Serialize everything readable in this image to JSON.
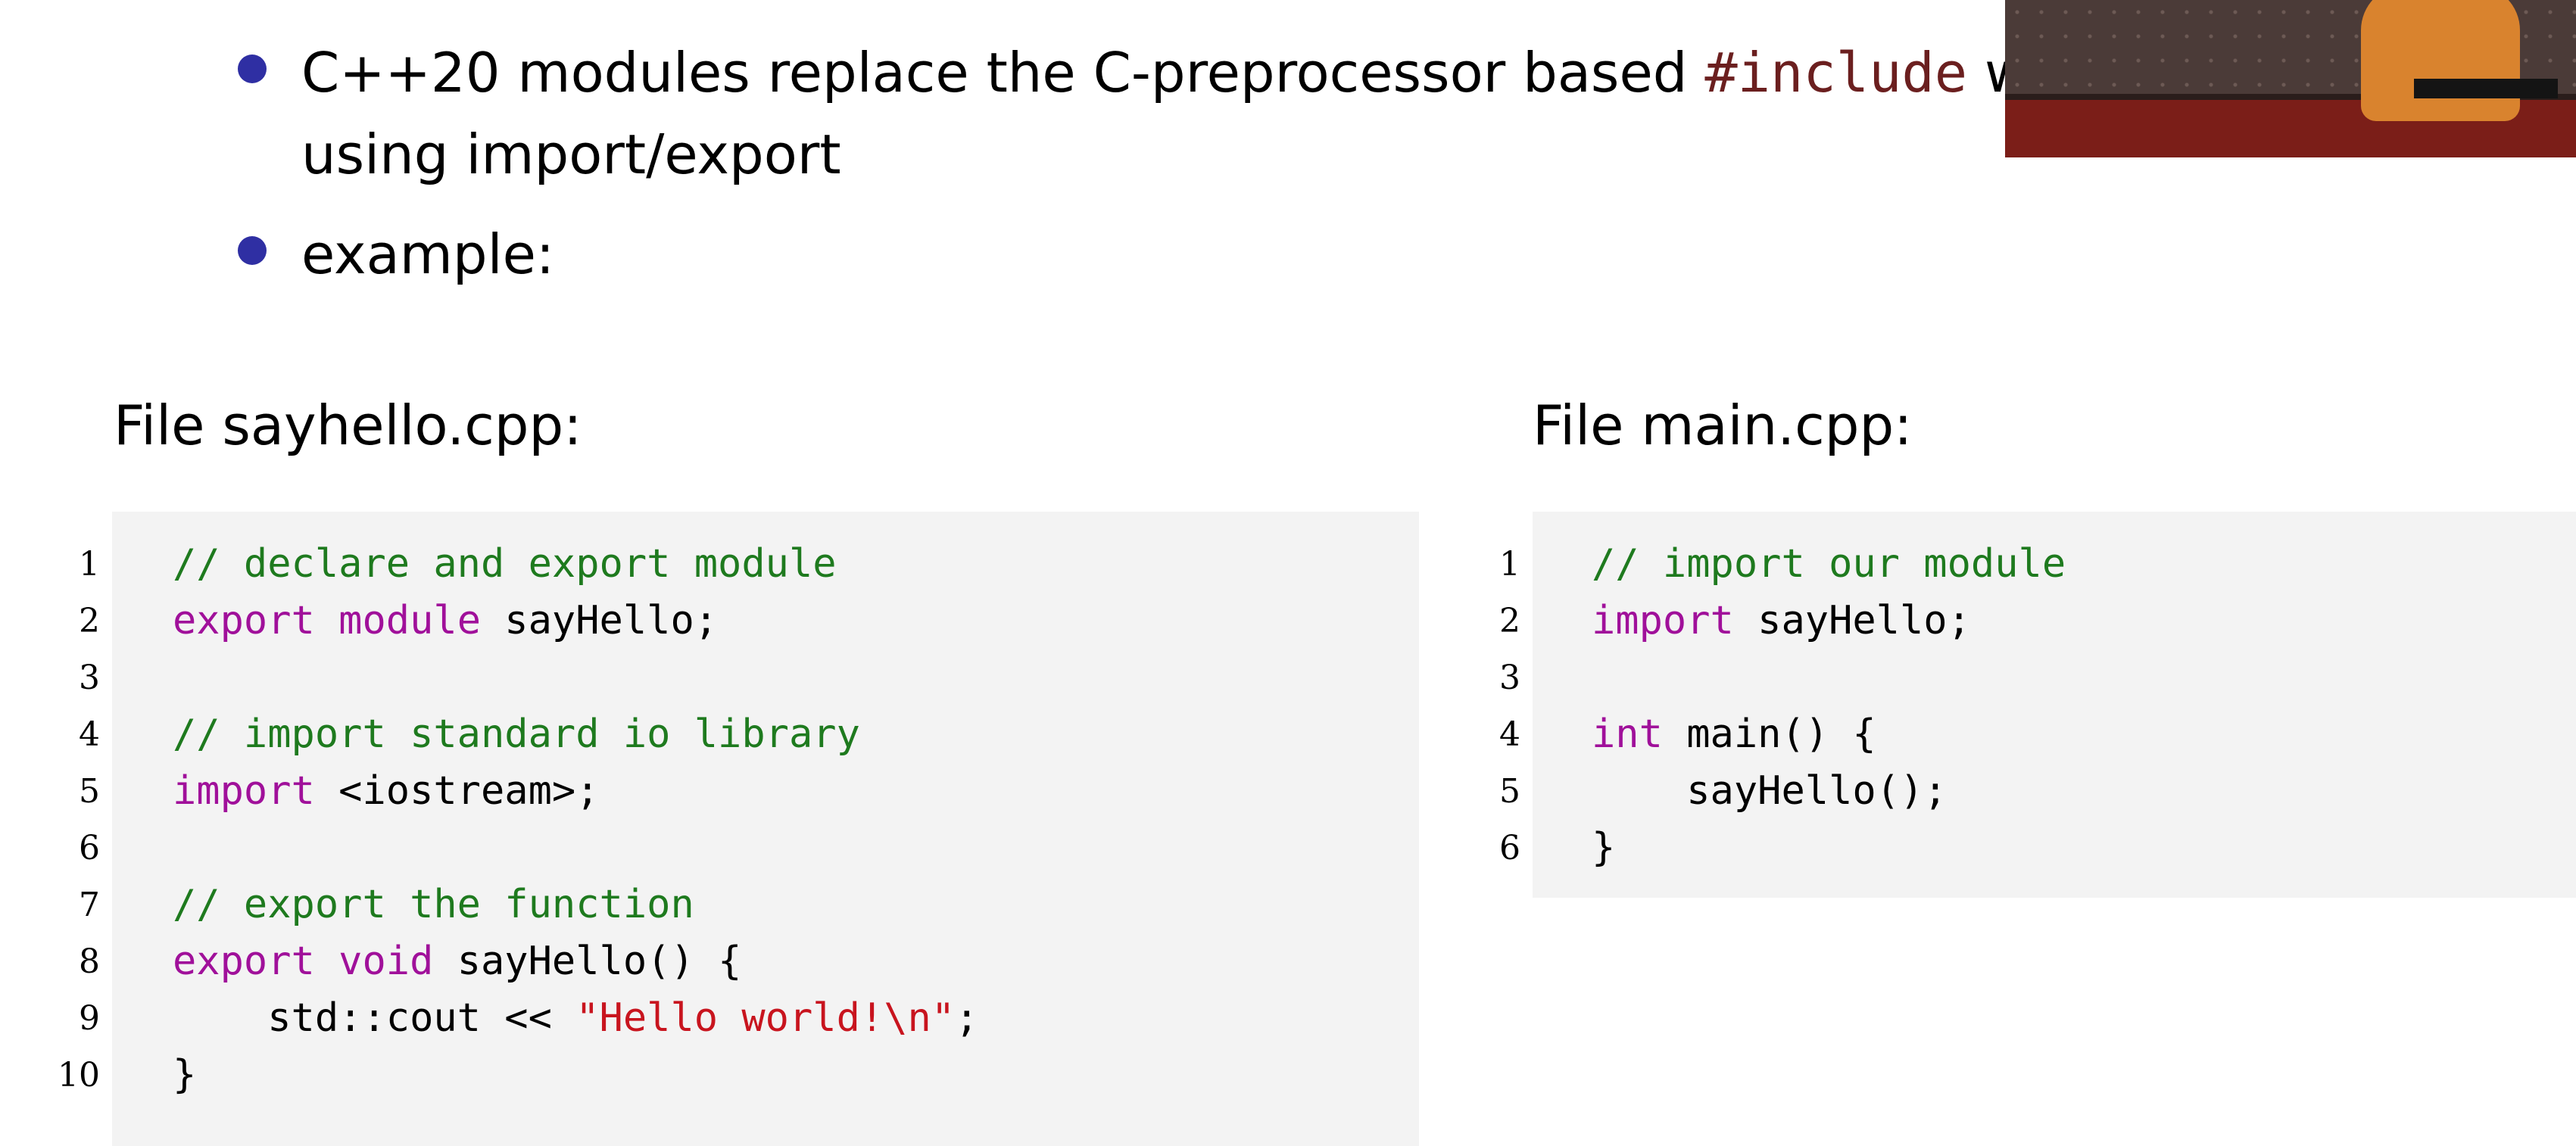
{
  "colors": {
    "bullet": "#2f2fa3",
    "comment": "#1e7a1e",
    "keyword": "#a0109a",
    "string": "#c8141e",
    "inline_code": "#6b1f1f",
    "code_background": "#f3f3f3"
  },
  "bullets": [
    {
      "line1_prefix": "C++20 modules replace the C-preprocessor based ",
      "line1_code": "#include",
      "line1_suffix": " w",
      "line2": "using import/export"
    },
    {
      "line1": "example:"
    }
  ],
  "left_file": {
    "title": "File sayhello.cpp:",
    "lines": [
      {
        "num": "1",
        "tokens": [
          {
            "type": "comment",
            "text": "// declare and export module"
          }
        ]
      },
      {
        "num": "2",
        "tokens": [
          {
            "type": "keyword",
            "text": "export"
          },
          {
            "type": "plain",
            "text": " "
          },
          {
            "type": "keyword",
            "text": "module"
          },
          {
            "type": "plain",
            "text": " sayHello;"
          }
        ]
      },
      {
        "num": "3",
        "tokens": []
      },
      {
        "num": "4",
        "tokens": [
          {
            "type": "comment",
            "text": "// import standard io library"
          }
        ]
      },
      {
        "num": "5",
        "tokens": [
          {
            "type": "keyword",
            "text": "import"
          },
          {
            "type": "plain",
            "text": " <iostream>;"
          }
        ]
      },
      {
        "num": "6",
        "tokens": []
      },
      {
        "num": "7",
        "tokens": [
          {
            "type": "comment",
            "text": "// export the function"
          }
        ]
      },
      {
        "num": "8",
        "tokens": [
          {
            "type": "keyword",
            "text": "export"
          },
          {
            "type": "plain",
            "text": " "
          },
          {
            "type": "keyword",
            "text": "void"
          },
          {
            "type": "plain",
            "text": " sayHello() {"
          }
        ]
      },
      {
        "num": "9",
        "tokens": [
          {
            "type": "plain",
            "text": "    std::cout << "
          },
          {
            "type": "string",
            "text": "\"Hello world!\\n\""
          },
          {
            "type": "plain",
            "text": ";"
          }
        ]
      },
      {
        "num": "10",
        "tokens": [
          {
            "type": "plain",
            "text": "}"
          }
        ]
      }
    ]
  },
  "right_file": {
    "title": "File main.cpp:",
    "lines": [
      {
        "num": "1",
        "tokens": [
          {
            "type": "comment",
            "text": "// import our module"
          }
        ]
      },
      {
        "num": "2",
        "tokens": [
          {
            "type": "keyword",
            "text": "import"
          },
          {
            "type": "plain",
            "text": " sayHello;"
          }
        ]
      },
      {
        "num": "3",
        "tokens": []
      },
      {
        "num": "4",
        "tokens": [
          {
            "type": "keyword",
            "text": "int"
          },
          {
            "type": "plain",
            "text": " main() {"
          }
        ]
      },
      {
        "num": "5",
        "tokens": [
          {
            "type": "plain",
            "text": "    sayHello();"
          }
        ]
      },
      {
        "num": "6",
        "tokens": [
          {
            "type": "plain",
            "text": "}"
          }
        ]
      }
    ]
  }
}
